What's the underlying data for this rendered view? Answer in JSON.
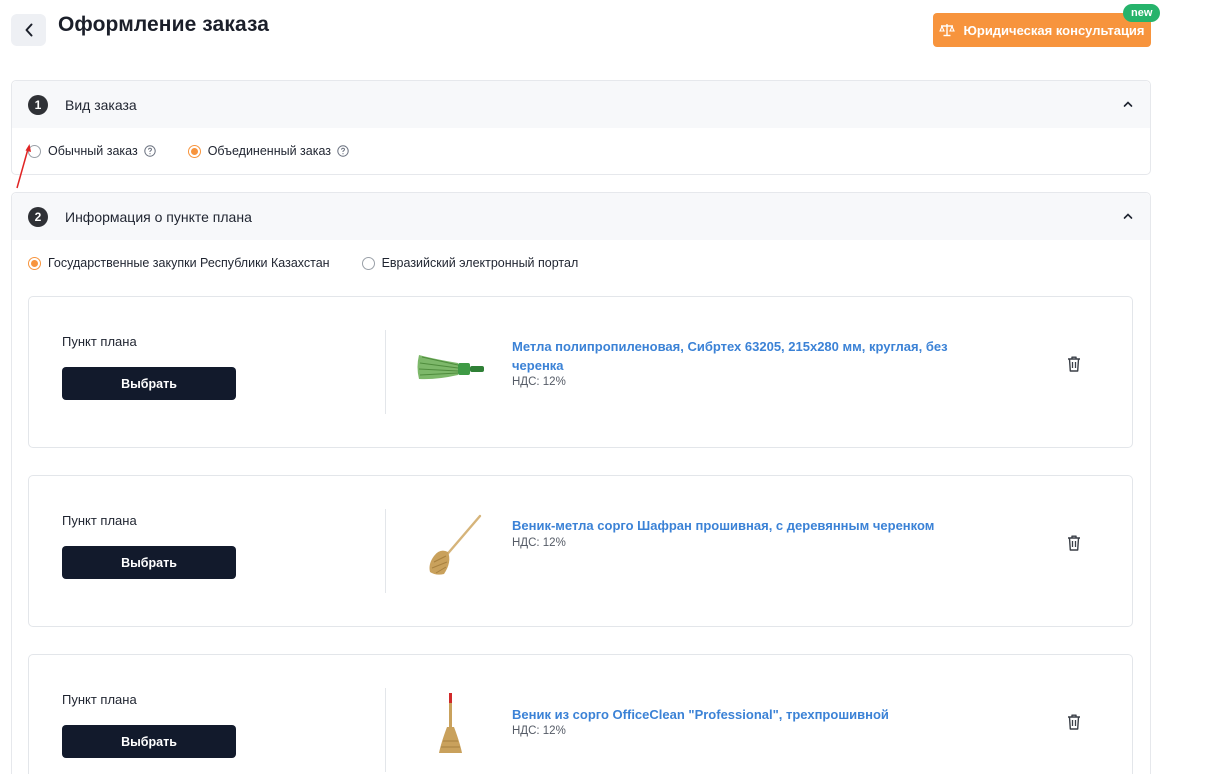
{
  "header": {
    "title": "Оформление заказа",
    "consult_label": "Юридическая консультация",
    "new_badge": "new"
  },
  "section1": {
    "number": "1",
    "title": "Вид заказа",
    "options": [
      {
        "label": "Обычный заказ",
        "checked": false
      },
      {
        "label": "Объединенный заказ",
        "checked": true
      }
    ]
  },
  "section2": {
    "number": "2",
    "title": "Информация о пункте плана",
    "options": [
      {
        "label": "Государственные закупки Республики Казахстан",
        "checked": true
      },
      {
        "label": "Евразийский электронный портал",
        "checked": false
      }
    ],
    "items": [
      {
        "label": "Пункт плана",
        "button": "Выбрать",
        "product": "Метла полипропиленовая, Сибртех 63205, 215х280 мм, круглая, без черенка",
        "vat": "НДС: 12%"
      },
      {
        "label": "Пункт плана",
        "button": "Выбрать",
        "product": "Веник-метла сорго Шафран прошивная, с деревянным черенком",
        "vat": "НДС: 12%"
      },
      {
        "label": "Пункт плана",
        "button": "Выбрать",
        "product": "Веник из сорго OfficeClean \"Professional\", трехпрошивной",
        "vat": "НДС: 12%"
      }
    ]
  },
  "colors": {
    "accent": "#f7943d",
    "badge": "#26b36b",
    "link": "#3b82d6",
    "button_dark": "#121a2c"
  }
}
